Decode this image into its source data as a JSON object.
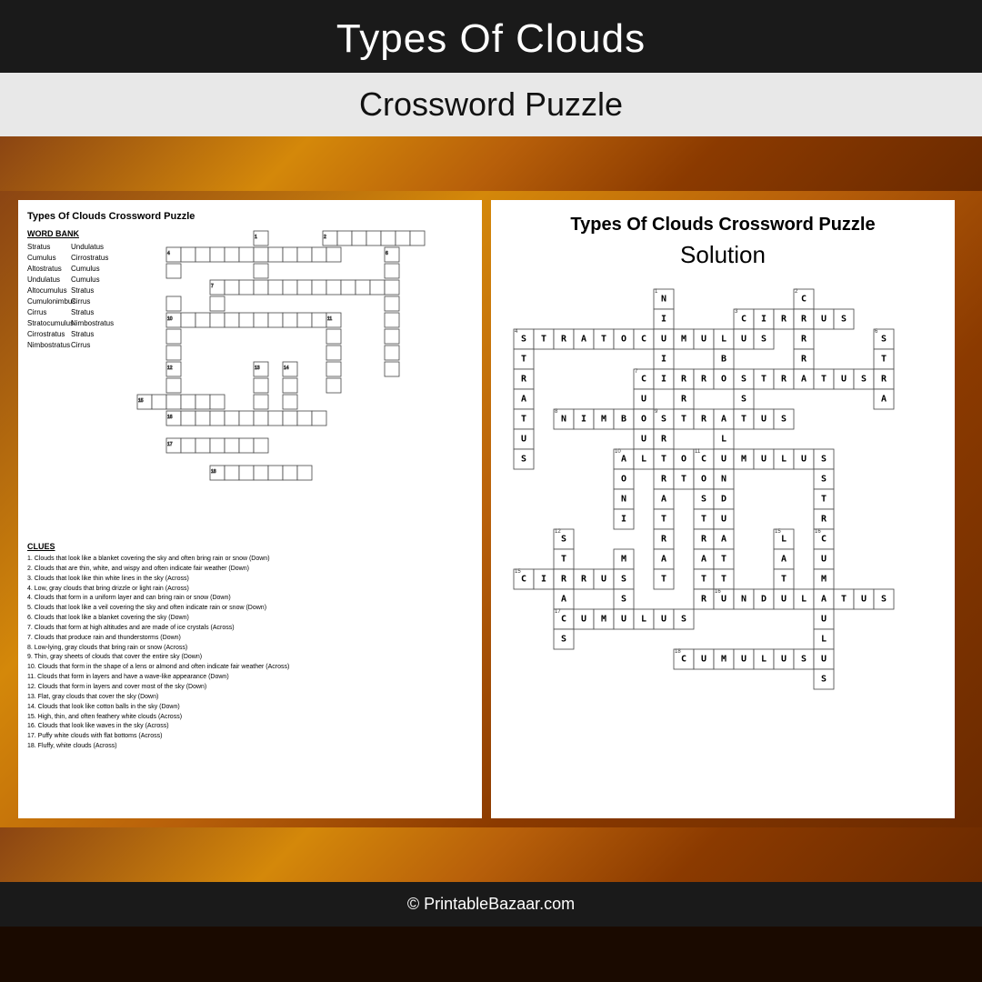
{
  "header": {
    "title": "Types Of Clouds",
    "subtitle": "Crossword Puzzle"
  },
  "left_panel": {
    "title": "Types Of Clouds Crossword Puzzle",
    "word_bank_label": "WORD BANK",
    "word_bank": [
      "Stratus",
      "Cumulus",
      "Altostratus",
      "Undulatus",
      "Altocumulus",
      "Cumulonimbus",
      "Cirrus",
      "Stratocumulus",
      "Cirrostratus",
      "Nimbostratus",
      "Undulatus",
      "Cirrostratus",
      "Cumulus",
      "Cumulus",
      "Stratus",
      "Cirrus",
      "Stratus",
      "Nimbostratus",
      "Stratus",
      "Cirrus"
    ],
    "clues_label": "CLUES",
    "clues": [
      "1. Clouds that look like a blanket covering the sky and often bring rain or snow (Down)",
      "2. Clouds that are thin, white, and wispy and often indicate fair weather (Down)",
      "3. Clouds that look like thin white lines in the sky (Across)",
      "4. Low, gray clouds that bring drizzle or light rain (Across)",
      "4. Clouds that form in a uniform layer and can bring rain or snow (Down)",
      "5. Clouds that look like a veil covering the sky and often indicate rain or snow (Down)",
      "6. Clouds that look like a blanket covering the sky (Down)",
      "7. Clouds that form at high altitudes and are made of ice crystals (Across)",
      "7. Clouds that produce rain and thunderstorms (Down)",
      "8. Low-lying, gray clouds that bring rain or snow (Across)",
      "9. Thin, gray sheets of clouds that cover the entire sky (Down)",
      "10. Clouds that form in the shape of a lens or almond and often indicate fair weather (Across)",
      "11. Clouds that form in layers and have a wave-like appearance (Down)",
      "12. Clouds that form in layers and cover most of the sky (Down)",
      "13. Flat, gray clouds that cover the sky (Down)",
      "14. Clouds that look like cotton balls in the sky (Down)",
      "15. High, thin, and often feathery white clouds (Across)",
      "16. Clouds that look like waves in the sky (Across)",
      "17. Puffy white clouds with flat bottoms (Across)",
      "18. Fluffy, white clouds (Across)"
    ]
  },
  "right_panel": {
    "title": "Types Of Clouds Crossword Puzzle",
    "solution_label": "Solution"
  },
  "footer": {
    "copyright": "© PrintableBazaar.com"
  }
}
